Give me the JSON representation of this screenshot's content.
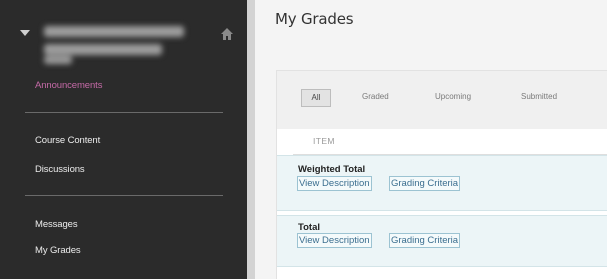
{
  "sidebar": {
    "nav": {
      "announcements": "Announcements",
      "course_content": "Course Content",
      "discussions": "Discussions",
      "messages": "Messages",
      "my_grades": "My Grades"
    },
    "icons": {
      "toggle": "collapse-triangle-icon",
      "home": "home-icon"
    },
    "active_color": "#c46aa6"
  },
  "main": {
    "page_title": "My Grades",
    "filters": [
      "All",
      "Graded",
      "Upcoming",
      "Submitted"
    ],
    "columns": {
      "item": "ITEM"
    },
    "items": [
      {
        "name": "Weighted Total",
        "links": [
          "View Description",
          "Grading Criteria"
        ]
      },
      {
        "name": "Total",
        "links": [
          "View Description",
          "Grading Criteria"
        ]
      }
    ]
  }
}
